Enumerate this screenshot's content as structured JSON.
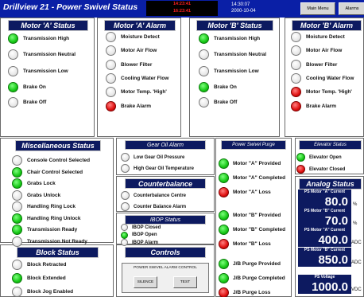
{
  "app": {
    "title": "Drillview 21 - Power Swivel Status",
    "alarm_time_1": "14:23:41",
    "alarm_time_2": "16:23:41",
    "clock_time": "14:30:07",
    "clock_date": "2000-10-04",
    "main_menu_label": "Main Menu",
    "alarms_label": "Alarms"
  },
  "motor_a_status": {
    "title": "Motor 'A' Status",
    "items": [
      {
        "label": "Transmission High",
        "state": "green"
      },
      {
        "label": "Transmission Neutral",
        "state": "off"
      },
      {
        "label": "Transmission Low",
        "state": "off"
      },
      {
        "label": "Brake On",
        "state": "green"
      },
      {
        "label": "Brake Off",
        "state": "off"
      }
    ]
  },
  "motor_a_alarm": {
    "title": "Motor 'A' Alarm",
    "items": [
      {
        "label": "Moisture Detect",
        "state": "off"
      },
      {
        "label": "Motor Air Flow",
        "state": "off"
      },
      {
        "label": "Blower Filter",
        "state": "off"
      },
      {
        "label": "Cooling Water Flow",
        "state": "off"
      },
      {
        "label": "Motor Temp. 'High'",
        "state": "off"
      },
      {
        "label": "Brake Alarm",
        "state": "red"
      }
    ]
  },
  "motor_b_status": {
    "title": "Motor 'B' Status",
    "items": [
      {
        "label": "Transmission High",
        "state": "green"
      },
      {
        "label": "Transmission Neutral",
        "state": "off"
      },
      {
        "label": "Transmission Low",
        "state": "off"
      },
      {
        "label": "Brake On",
        "state": "green"
      },
      {
        "label": "Brake Off",
        "state": "off"
      }
    ]
  },
  "motor_b_alarm": {
    "title": "Motor 'B' Alarm",
    "items": [
      {
        "label": "Moisture Detect",
        "state": "off"
      },
      {
        "label": "Motor Air Flow",
        "state": "off"
      },
      {
        "label": "Blower Filter",
        "state": "off"
      },
      {
        "label": "Cooling Water Flow",
        "state": "off"
      },
      {
        "label": "Motor Temp. 'High'",
        "state": "red"
      },
      {
        "label": "Brake Alarm",
        "state": "red"
      }
    ]
  },
  "misc_status": {
    "title": "Miscellaneous Status",
    "items": [
      {
        "label": "Console Control Selected",
        "state": "off"
      },
      {
        "label": "Chair Control Selected",
        "state": "green"
      },
      {
        "label": "Grabs Lock",
        "state": "green"
      },
      {
        "label": "Grabs Unlock",
        "state": "off"
      },
      {
        "label": "Handling Ring Lock",
        "state": "off"
      },
      {
        "label": "Handling Ring Unlock",
        "state": "green"
      },
      {
        "label": "Transmission Ready",
        "state": "green"
      },
      {
        "label": "Transmission Not Ready",
        "state": "off"
      }
    ]
  },
  "gear_oil_alarm": {
    "title": "Gear Oil Alarm",
    "items": [
      {
        "label": "Low Gear Oil Pressure",
        "state": "off"
      },
      {
        "label": "High Gear Oil Temperature",
        "state": "off"
      }
    ]
  },
  "counterbalance": {
    "title": "Counterbalance",
    "items": [
      {
        "label": "Counterbalance Centre",
        "state": "off"
      },
      {
        "label": "Counter Balance Alarm",
        "state": "off"
      }
    ]
  },
  "ibop_status": {
    "title": "IBOP Status",
    "items": [
      {
        "label": "IBOP Closed",
        "state": "off"
      },
      {
        "label": "IBOP Open",
        "state": "green"
      },
      {
        "label": "IBOP Alarm",
        "state": "off"
      }
    ]
  },
  "power_swivel_purge": {
    "title": "Power Swivel Purge",
    "items": [
      {
        "label": "Motor \"A\" Provided",
        "state": "green"
      },
      {
        "label": "Motor \"A\" Completed",
        "state": "green"
      },
      {
        "label": "Motor \"A\" Loss",
        "state": "red"
      },
      {
        "label": "Motor \"B\" Provided",
        "state": "green"
      },
      {
        "label": "Motor \"B\" Completed",
        "state": "green"
      },
      {
        "label": "Motor \"B\" Loss",
        "state": "red"
      },
      {
        "label": "J/B Purge Provided",
        "state": "green"
      },
      {
        "label": "J/B Purge Completed",
        "state": "green"
      },
      {
        "label": "J/B Purge Loss",
        "state": "red"
      }
    ]
  },
  "elevator_status": {
    "title": "Elevator Status",
    "items": [
      {
        "label": "Elevator Open",
        "state": "green"
      },
      {
        "label": "Elevator Closed",
        "state": "red"
      }
    ]
  },
  "analog_status": {
    "title": "Analog Status",
    "items": [
      {
        "label": "PS Motor \"A\" Current",
        "value": "80.0",
        "unit": "%"
      },
      {
        "label": "PS Motor \"B\" Current",
        "value": "70.0",
        "unit": "%"
      },
      {
        "label": "PS Motor \"A\" Current",
        "value": "400.0",
        "unit": "ADC"
      },
      {
        "label": "PS Motor \"B\" Current",
        "value": "850.0",
        "unit": "ADC"
      },
      {
        "label": "PS Voltage",
        "value": "1000.0",
        "unit": "VDC"
      }
    ]
  },
  "block_status": {
    "title": "Block Status",
    "items": [
      {
        "label": "Block Retracted",
        "state": "off"
      },
      {
        "label": "Block Extended",
        "state": "green"
      },
      {
        "label": "Block Jog Enabled",
        "state": "off"
      }
    ]
  },
  "controls": {
    "title": "Controls",
    "caption": "POWER SWIVEL ALARM CONTROL",
    "silence_label": "SILENCE",
    "test_label": "TEST"
  }
}
